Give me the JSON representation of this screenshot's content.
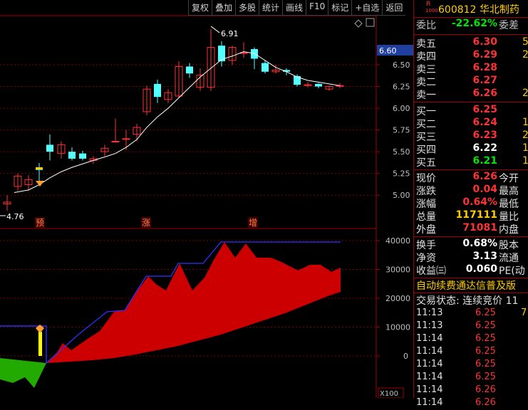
{
  "toolbar": [
    "复权",
    "叠加",
    "多股",
    "统计",
    "画线",
    "F10",
    "标记",
    "+自选",
    "返回"
  ],
  "stock": {
    "r_mark": "R",
    "code_small": "1000",
    "title": "600812 华北制药"
  },
  "kline_axis": [
    "6.50",
    "6.25",
    "6.00",
    "5.75",
    "5.50",
    "5.25",
    "5.00"
  ],
  "current_price_tag": "6.60",
  "annotations": {
    "high": "6.91",
    "low": "4.76"
  },
  "markers": [
    "预",
    "涨",
    "增"
  ],
  "volume_axis": [
    "40000",
    "30000",
    "20000",
    "10000",
    "0"
  ],
  "volume_unit": "X100",
  "weibi": {
    "label": "委比",
    "value": "-22.62%",
    "label2": "委差"
  },
  "asks": [
    {
      "label": "卖五",
      "price": "6.30",
      "vol": "5"
    },
    {
      "label": "卖四",
      "price": "6.29",
      "vol": "2"
    },
    {
      "label": "卖三",
      "price": "6.28",
      "vol": ""
    },
    {
      "label": "卖二",
      "price": "6.27",
      "vol": ""
    },
    {
      "label": "卖一",
      "price": "6.26",
      "vol": "2"
    }
  ],
  "bids": [
    {
      "label": "买一",
      "price": "6.25",
      "vol": "",
      "color": "red"
    },
    {
      "label": "买二",
      "price": "6.24",
      "vol": "1",
      "color": "red"
    },
    {
      "label": "买三",
      "price": "6.23",
      "vol": "2",
      "color": "red"
    },
    {
      "label": "买四",
      "price": "6.22",
      "vol": "1",
      "color": "white"
    },
    {
      "label": "买五",
      "price": "6.21",
      "vol": "1",
      "color": "green"
    }
  ],
  "stats": [
    {
      "label": "现价",
      "value": "6.26",
      "label2": "今开",
      "color": "red"
    },
    {
      "label": "涨跌",
      "value": "0.04",
      "label2": "最高",
      "color": "red"
    },
    {
      "label": "涨幅",
      "value": "0.64%",
      "label2": "最低",
      "color": "red"
    },
    {
      "label": "总量",
      "value": "117111",
      "label2": "量比",
      "color": "yellow"
    },
    {
      "label": "外盘",
      "value": "71081",
      "label2": "内盘",
      "color": "red"
    }
  ],
  "stats2": [
    {
      "label": "换手",
      "value": "0.68%",
      "label2": "股本",
      "color": "white"
    },
    {
      "label": "净资",
      "value": "3.13",
      "label2": "流通",
      "color": "white"
    },
    {
      "label": "收益㈢",
      "value": "0.060",
      "label2": "PE(动",
      "color": "white"
    }
  ],
  "promo": "自动续费通达信普及版",
  "trade_status": "交易状态: 连续竞价 11",
  "ticks": [
    {
      "time": "11:13",
      "price": "6.25",
      "vol": "7"
    },
    {
      "time": "11:13",
      "price": "6.25",
      "vol": ""
    },
    {
      "time": "11:14",
      "price": "6.25",
      "vol": ""
    },
    {
      "time": "11:14",
      "price": "6.25",
      "vol": ""
    },
    {
      "time": "11:14",
      "price": "6.25",
      "vol": ""
    },
    {
      "time": "11:14",
      "price": "6.25",
      "vol": ""
    },
    {
      "time": "11:14",
      "price": "6.26",
      "vol": ""
    },
    {
      "time": "11:14",
      "price": "6.26",
      "vol": ""
    }
  ],
  "colors": {
    "up": "#ff3232",
    "down": "#54ffff",
    "ma": "#ffffff",
    "area": "#cc0000",
    "area_down": "#22aa00",
    "line": "#3030ff"
  }
}
